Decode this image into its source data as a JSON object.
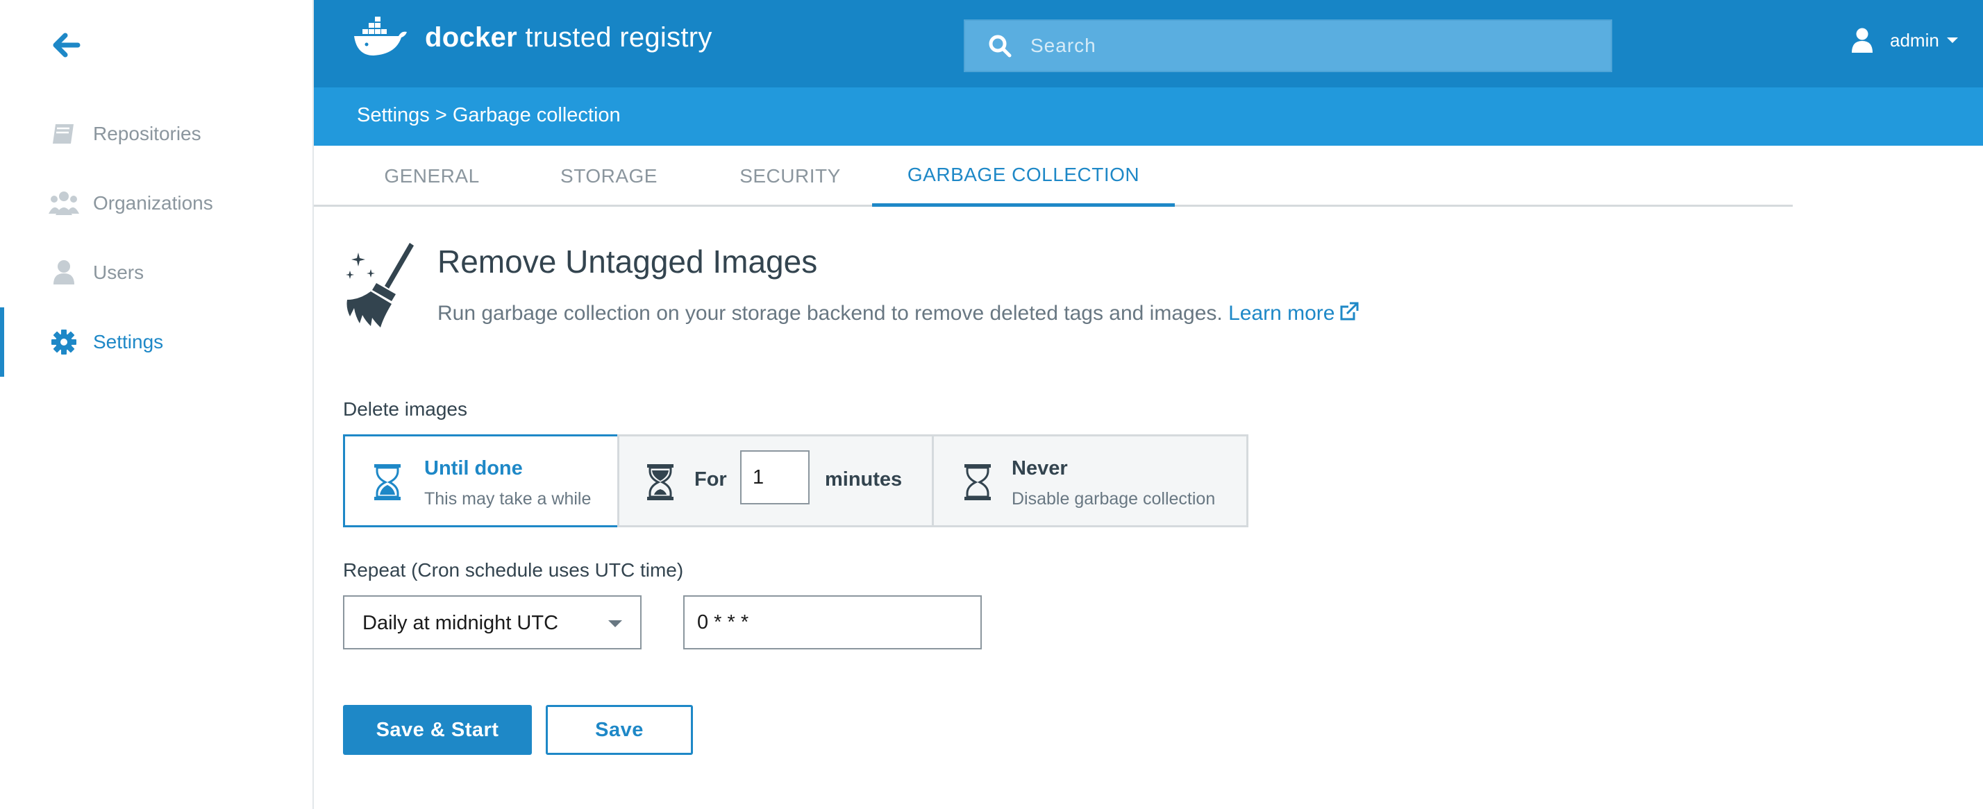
{
  "app": {
    "logo_text_bold": "docker",
    "logo_text_rest": " trusted registry"
  },
  "search": {
    "placeholder": "Search",
    "value": ""
  },
  "user": {
    "name": "admin"
  },
  "sidebar": {
    "items": [
      {
        "label": "Repositories",
        "icon": "book-icon",
        "active": false
      },
      {
        "label": "Organizations",
        "icon": "organizations-icon",
        "active": false
      },
      {
        "label": "Users",
        "icon": "user-icon",
        "active": false
      },
      {
        "label": "Settings",
        "icon": "gear-icon",
        "active": true
      }
    ]
  },
  "breadcrumb": {
    "text": "Settings > Garbage collection"
  },
  "tabs": [
    {
      "label": "GENERAL",
      "active": false
    },
    {
      "label": "STORAGE",
      "active": false
    },
    {
      "label": "SECURITY",
      "active": false
    },
    {
      "label": "GARBAGE COLLECTION",
      "active": true
    }
  ],
  "section": {
    "title": "Remove Untagged Images",
    "description": "Run garbage collection on your storage backend to remove deleted tags and images.",
    "learn_more": "Learn more"
  },
  "delete_images": {
    "label": "Delete images",
    "selected": "until_done",
    "until_done": {
      "title": "Until done",
      "subtitle": "This may take a while"
    },
    "for": {
      "prefix": "For",
      "value": "1",
      "suffix": "minutes"
    },
    "never": {
      "title": "Never",
      "subtitle": "Disable garbage collection"
    }
  },
  "repeat": {
    "label": "Repeat (Cron schedule uses UTC time)",
    "selected_option": "Daily at midnight UTC",
    "cron_value": "0 * * *"
  },
  "actions": {
    "save_start_label": "Save & Start",
    "save_label": "Save"
  },
  "colors": {
    "brand_blue": "#1785c6",
    "breadcrumb_blue": "#2299dc",
    "accent": "#1e88c7"
  }
}
